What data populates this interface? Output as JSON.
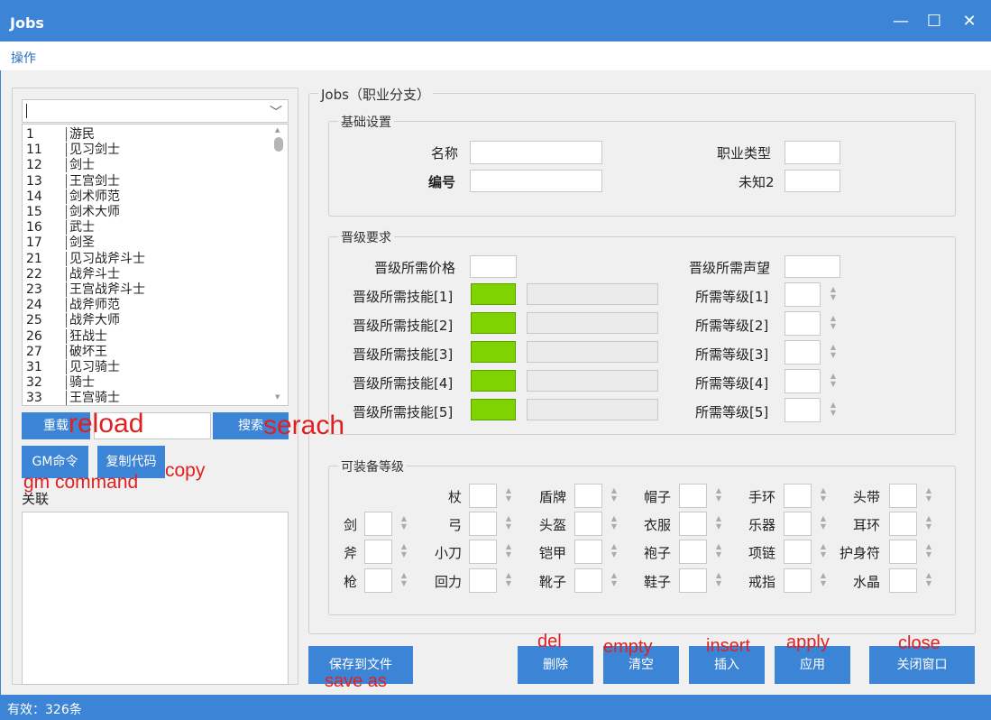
{
  "window": {
    "title": "Jobs",
    "controls": [
      "—",
      "☐",
      "✕"
    ]
  },
  "menu": {
    "ops": "操作"
  },
  "left": {
    "combo_value": "",
    "rows": [
      {
        "id": "1",
        "name": "游民"
      },
      {
        "id": "11",
        "name": "见习剑士"
      },
      {
        "id": "12",
        "name": "剑士"
      },
      {
        "id": "13",
        "name": "王宫剑士"
      },
      {
        "id": "14",
        "name": "剑术师范"
      },
      {
        "id": "15",
        "name": "剑术大师"
      },
      {
        "id": "16",
        "name": "武士"
      },
      {
        "id": "17",
        "name": "剑圣"
      },
      {
        "id": "21",
        "name": "见习战斧斗士"
      },
      {
        "id": "22",
        "name": "战斧斗士"
      },
      {
        "id": "23",
        "name": "王宫战斧斗士"
      },
      {
        "id": "24",
        "name": "战斧师范"
      },
      {
        "id": "25",
        "name": "战斧大师"
      },
      {
        "id": "26",
        "name": "狂战士"
      },
      {
        "id": "27",
        "name": "破坏王"
      },
      {
        "id": "31",
        "name": "见习骑士"
      },
      {
        "id": "32",
        "name": "骑士"
      },
      {
        "id": "33",
        "name": "王宫骑士"
      }
    ],
    "reload_label": "重载",
    "search_label": "搜索",
    "search_value": "",
    "gm_label": "GM命令",
    "copy_label": "复制代码",
    "related_label": "关联"
  },
  "jobs_group": "Jobs（职业分支）",
  "basic": {
    "title": "基础设置",
    "name_label": "名称",
    "id_label": "编号",
    "type_label": "职业类型",
    "unknown2_label": "未知2"
  },
  "promote": {
    "title": "晋级要求",
    "price_label": "晋级所需价格",
    "fame_label": "晋级所需声望",
    "skill_labels": [
      "晋级所需技能[1]",
      "晋级所需技能[2]",
      "晋级所需技能[3]",
      "晋级所需技能[4]",
      "晋级所需技能[5]"
    ],
    "level_labels": [
      "所需等级[1]",
      "所需等级[2]",
      "所需等级[3]",
      "所需等级[4]",
      "所需等级[5]"
    ]
  },
  "equip": {
    "title": "可装备等级",
    "col1": [
      "",
      "剑",
      "斧",
      "枪"
    ],
    "col2": [
      "杖",
      "弓",
      "小刀",
      "回力"
    ],
    "col3": [
      "盾牌",
      "头盔",
      "铠甲",
      "靴子"
    ],
    "col4": [
      "帽子",
      "衣服",
      "袍子",
      "鞋子"
    ],
    "col5": [
      "手环",
      "乐器",
      "项链",
      "戒指"
    ],
    "col6": [
      "头带",
      "耳环",
      "护身符",
      "水晶"
    ]
  },
  "buttons": {
    "save_label": "保存到文件",
    "del_label": "删除",
    "empty_label": "清空",
    "insert_label": "插入",
    "apply_label": "应用",
    "close_label": "关闭窗口"
  },
  "annotations": {
    "reload": "reload",
    "search": "serach",
    "copy": "copy",
    "gm": "gm command",
    "save": "save as",
    "del": "del",
    "empty": "empty",
    "insert": "insert",
    "apply": "apply",
    "close": "close"
  },
  "status": {
    "text": "有效：326条"
  },
  "colors": {
    "titlebar": "#3c84d6",
    "skill_box": "#7ed300",
    "annotation": "#e02020"
  }
}
